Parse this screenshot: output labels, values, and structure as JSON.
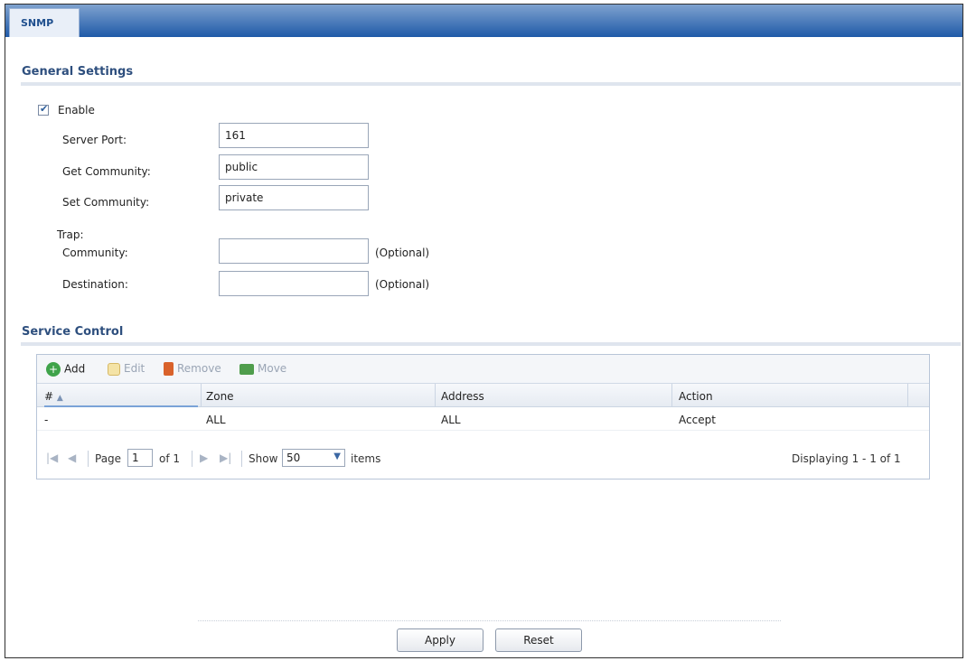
{
  "tab": {
    "label": "SNMP"
  },
  "general": {
    "title": "General Settings",
    "enable_label": "Enable",
    "enable_checked": true,
    "server_port_label": "Server Port:",
    "server_port_value": "161",
    "get_community_label": "Get Community:",
    "get_community_value": "public",
    "set_community_label": "Set Community:",
    "set_community_value": "private",
    "trap_label": "Trap:",
    "trap_community_label": "Community:",
    "trap_community_value": "",
    "trap_destination_label": "Destination:",
    "trap_destination_value": "",
    "optional_text": "(Optional)"
  },
  "service": {
    "title": "Service Control",
    "toolbar": {
      "add": "Add",
      "edit": "Edit",
      "remove": "Remove",
      "move": "Move"
    },
    "columns": [
      "#",
      "Zone",
      "Address",
      "Action"
    ],
    "rows": [
      {
        "num": "-",
        "zone": "ALL",
        "address": "ALL",
        "action": "Accept"
      }
    ],
    "pager": {
      "page_label": "Page",
      "page_value": "1",
      "of_label": "of 1",
      "show_label": "Show",
      "show_value": "50",
      "items_label": "items",
      "displaying": "Displaying 1 - 1 of 1"
    }
  },
  "buttons": {
    "apply": "Apply",
    "reset": "Reset"
  },
  "colors": {
    "tabbar_start": "#7fa2cf",
    "tabbar_end": "#1f5aa8",
    "section_title": "#2e4f7e"
  }
}
